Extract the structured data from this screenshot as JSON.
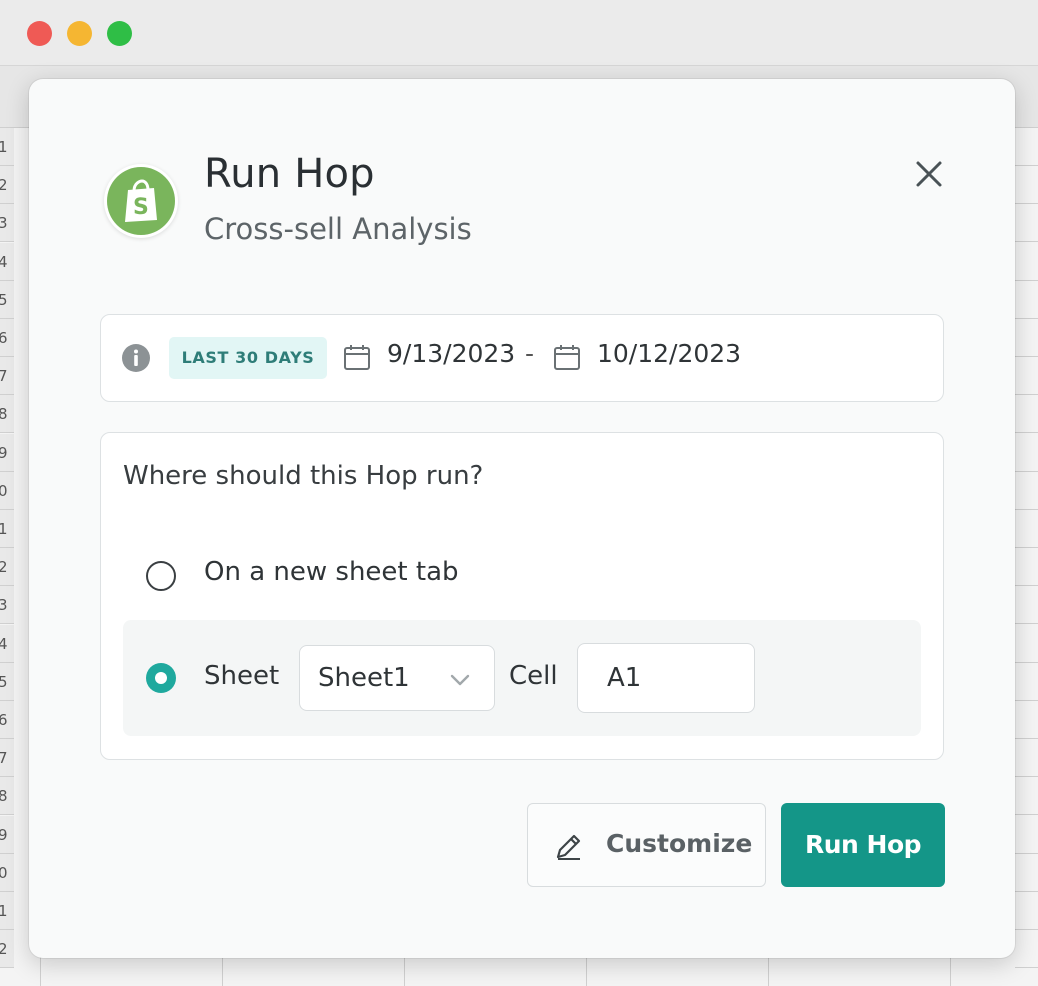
{
  "window": {
    "traffic_lights": [
      "close",
      "minimize",
      "zoom"
    ],
    "colors": {
      "close": "#ef5a55",
      "minimize": "#f5b632",
      "zoom": "#2fbe46"
    }
  },
  "spreadsheet": {
    "row_numbers": [
      "1",
      "2",
      "3",
      "4",
      "5",
      "6",
      "7",
      "8",
      "9",
      "0",
      "1",
      "2",
      "3",
      "4",
      "5",
      "6",
      "7",
      "8",
      "9",
      "0",
      "1",
      "2"
    ]
  },
  "dialog": {
    "logo_icon": "shopify-bag-icon",
    "title": "Run Hop",
    "subtitle": "Cross-sell Analysis",
    "close_icon": "close-icon",
    "date_range": {
      "info_icon": "info-icon",
      "badge": "LAST 30 DAYS",
      "start_date": "9/13/2023",
      "separator": "-",
      "end_date": "10/12/2023",
      "calendar_icon": "calendar-icon"
    },
    "destination": {
      "question": "Where should this Hop run?",
      "options": [
        {
          "label": "On a new sheet tab",
          "selected": false
        },
        {
          "label": "Sheet",
          "selected": true
        }
      ],
      "sheet_select_value": "Sheet1",
      "cell_label": "Cell",
      "cell_value": "A1"
    },
    "buttons": {
      "customize": "Customize",
      "run": "Run Hop"
    },
    "colors": {
      "accent": "#149688",
      "badge_bg": "#e2f6f5",
      "badge_text": "#2e7d78",
      "radio_selected": "#1fa99e",
      "shopify_green": "#7ab55c"
    }
  }
}
